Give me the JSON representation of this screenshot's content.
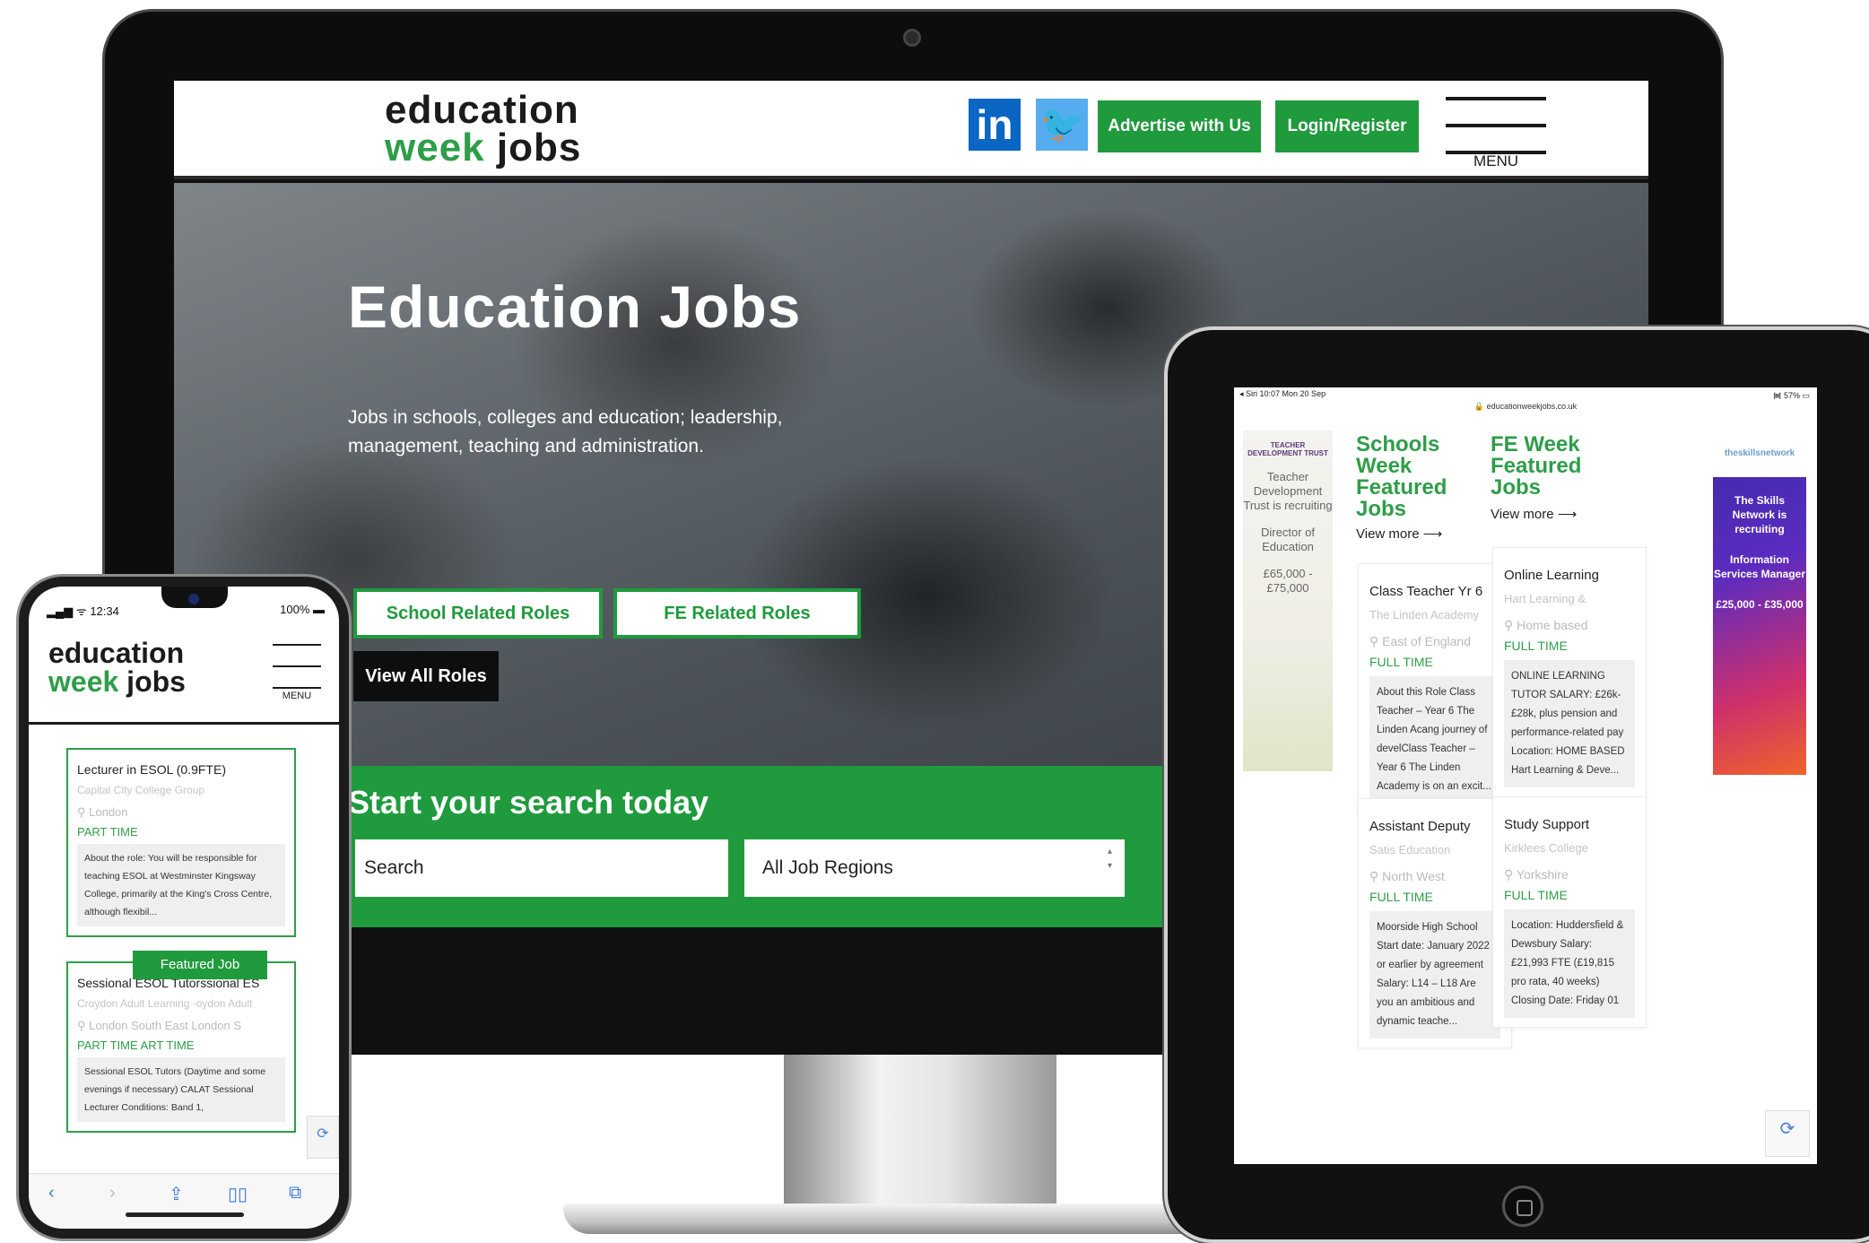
{
  "monitor": {
    "logo_line1": "education",
    "logo_word_green": "week",
    "logo_word_dark": "jobs",
    "social_linkedin": "in",
    "social_twitter": "🐦",
    "advertise_label": "Advertise with Us",
    "login_label": "Login/Register",
    "menu_label": "MENU",
    "hero_title": "Education Jobs",
    "hero_subtitle": "Jobs in schools, colleges and education; leadership, management, teaching and administration.",
    "school_roles_label": "School Related Roles",
    "fe_roles_label": "FE Related Roles",
    "all_roles_label": "View All Roles",
    "search_title": "Start your search today",
    "search_placeholder": "Search",
    "region_value": "All Job Regions"
  },
  "tablet": {
    "status_left": "◂ Siri  10:07  Mon 20 Sep",
    "status_right": "᯼ 57% ▭",
    "url": "🔒 educationweekjobs.co.uk",
    "ad_left": {
      "logo": "TEACHER DEVELOPMENT TRUST",
      "line1": "Teacher Development Trust is recruiting",
      "line2": "Director of Education",
      "salary": "£65,000 - £75,000"
    },
    "ad_right": {
      "logo": "theskillsnetwork",
      "line1": "The Skills Network is recruiting",
      "line2": "Information Services Manager",
      "salary": "£25,000 - £35,000"
    },
    "schools_heading": "Schools Week Featured Jobs",
    "fe_heading": "FE Week Featured Jobs",
    "view_more": "View more ⟶",
    "cards": [
      {
        "title": "Class Teacher Yr 6",
        "company": "The Linden Academy",
        "location": "East of England",
        "type": "FULL TIME",
        "desc": "About this Role Class Teacher – Year 6 The Linden Acang journey of develClass Teacher – Year 6 The Linden Academy is on an excit..."
      },
      {
        "title": "Online Learning",
        "company": "Hart Learning &",
        "location": "Home based",
        "type": "FULL TIME",
        "desc": "ONLINE LEARNING TUTOR SALARY: £26k-£28k, plus pension and performance-related pay Location: HOME BASED  Hart Learning & Deve..."
      },
      {
        "title": "Assistant Deputy",
        "company": "Satis Education",
        "location": "North West",
        "type": "FULL TIME",
        "desc": "Moorside High School Start date: January 2022 or earlier by agreement Salary: L14 – L18 Are you an ambitious and dynamic teache..."
      },
      {
        "title": "Study Support",
        "company": "Kirklees College",
        "location": "Yorkshire",
        "type": "FULL TIME",
        "desc": "Location: Huddersfield & Dewsbury Salary: £21,993 FTE (£19,815 pro rata, 40 weeks) Closing Date: Friday 01"
      }
    ]
  },
  "phone": {
    "time": "12:34",
    "signal": "▂▄▆ ᯤ",
    "battery": "100% ▬",
    "logo_line1": "education",
    "logo_word_green": "week",
    "logo_word_dark": "jobs",
    "menu_label": "MENU",
    "featured_label": "Featured Job",
    "cards": [
      {
        "title": "Lecturer in ESOL (0.9FTE)",
        "company": "Capital City College Group",
        "location": "London",
        "type": "PART TIME",
        "desc": "About the role: You will be responsible for teaching ESOL at Westminster Kingsway College, primarily at the King's Cross Centre, although flexibil..."
      },
      {
        "title": "Sessional ESOL Tutorssional ES",
        "company": "Croydon Adult Learning ·oydon Adult",
        "location": "London South East  London S",
        "type": "PART TIME          ART TIME",
        "desc": "Sessional ESOL Tutors (Daytime and some evenings if necessary) CALAT Sessional Lecturer Conditions: Band 1,"
      }
    ],
    "toolbar": {
      "back": "‹",
      "forward": "›",
      "share": "⇪",
      "bookmarks": "▯▯",
      "tabs": "⧉"
    }
  }
}
